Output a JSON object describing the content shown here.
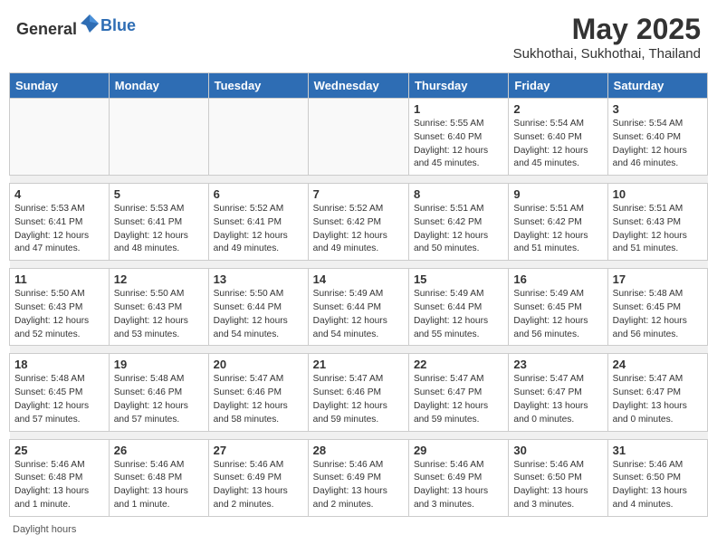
{
  "header": {
    "logo_general": "General",
    "logo_blue": "Blue",
    "main_title": "May 2025",
    "subtitle": "Sukhothai, Sukhothai, Thailand"
  },
  "days_of_week": [
    "Sunday",
    "Monday",
    "Tuesday",
    "Wednesday",
    "Thursday",
    "Friday",
    "Saturday"
  ],
  "weeks": [
    [
      {
        "day": "",
        "info": ""
      },
      {
        "day": "",
        "info": ""
      },
      {
        "day": "",
        "info": ""
      },
      {
        "day": "",
        "info": ""
      },
      {
        "day": "1",
        "info": "Sunrise: 5:55 AM\nSunset: 6:40 PM\nDaylight: 12 hours\nand 45 minutes."
      },
      {
        "day": "2",
        "info": "Sunrise: 5:54 AM\nSunset: 6:40 PM\nDaylight: 12 hours\nand 45 minutes."
      },
      {
        "day": "3",
        "info": "Sunrise: 5:54 AM\nSunset: 6:40 PM\nDaylight: 12 hours\nand 46 minutes."
      }
    ],
    [
      {
        "day": "4",
        "info": "Sunrise: 5:53 AM\nSunset: 6:41 PM\nDaylight: 12 hours\nand 47 minutes."
      },
      {
        "day": "5",
        "info": "Sunrise: 5:53 AM\nSunset: 6:41 PM\nDaylight: 12 hours\nand 48 minutes."
      },
      {
        "day": "6",
        "info": "Sunrise: 5:52 AM\nSunset: 6:41 PM\nDaylight: 12 hours\nand 49 minutes."
      },
      {
        "day": "7",
        "info": "Sunrise: 5:52 AM\nSunset: 6:42 PM\nDaylight: 12 hours\nand 49 minutes."
      },
      {
        "day": "8",
        "info": "Sunrise: 5:51 AM\nSunset: 6:42 PM\nDaylight: 12 hours\nand 50 minutes."
      },
      {
        "day": "9",
        "info": "Sunrise: 5:51 AM\nSunset: 6:42 PM\nDaylight: 12 hours\nand 51 minutes."
      },
      {
        "day": "10",
        "info": "Sunrise: 5:51 AM\nSunset: 6:43 PM\nDaylight: 12 hours\nand 51 minutes."
      }
    ],
    [
      {
        "day": "11",
        "info": "Sunrise: 5:50 AM\nSunset: 6:43 PM\nDaylight: 12 hours\nand 52 minutes."
      },
      {
        "day": "12",
        "info": "Sunrise: 5:50 AM\nSunset: 6:43 PM\nDaylight: 12 hours\nand 53 minutes."
      },
      {
        "day": "13",
        "info": "Sunrise: 5:50 AM\nSunset: 6:44 PM\nDaylight: 12 hours\nand 54 minutes."
      },
      {
        "day": "14",
        "info": "Sunrise: 5:49 AM\nSunset: 6:44 PM\nDaylight: 12 hours\nand 54 minutes."
      },
      {
        "day": "15",
        "info": "Sunrise: 5:49 AM\nSunset: 6:44 PM\nDaylight: 12 hours\nand 55 minutes."
      },
      {
        "day": "16",
        "info": "Sunrise: 5:49 AM\nSunset: 6:45 PM\nDaylight: 12 hours\nand 56 minutes."
      },
      {
        "day": "17",
        "info": "Sunrise: 5:48 AM\nSunset: 6:45 PM\nDaylight: 12 hours\nand 56 minutes."
      }
    ],
    [
      {
        "day": "18",
        "info": "Sunrise: 5:48 AM\nSunset: 6:45 PM\nDaylight: 12 hours\nand 57 minutes."
      },
      {
        "day": "19",
        "info": "Sunrise: 5:48 AM\nSunset: 6:46 PM\nDaylight: 12 hours\nand 57 minutes."
      },
      {
        "day": "20",
        "info": "Sunrise: 5:47 AM\nSunset: 6:46 PM\nDaylight: 12 hours\nand 58 minutes."
      },
      {
        "day": "21",
        "info": "Sunrise: 5:47 AM\nSunset: 6:46 PM\nDaylight: 12 hours\nand 59 minutes."
      },
      {
        "day": "22",
        "info": "Sunrise: 5:47 AM\nSunset: 6:47 PM\nDaylight: 12 hours\nand 59 minutes."
      },
      {
        "day": "23",
        "info": "Sunrise: 5:47 AM\nSunset: 6:47 PM\nDaylight: 13 hours\nand 0 minutes."
      },
      {
        "day": "24",
        "info": "Sunrise: 5:47 AM\nSunset: 6:47 PM\nDaylight: 13 hours\nand 0 minutes."
      }
    ],
    [
      {
        "day": "25",
        "info": "Sunrise: 5:46 AM\nSunset: 6:48 PM\nDaylight: 13 hours\nand 1 minute."
      },
      {
        "day": "26",
        "info": "Sunrise: 5:46 AM\nSunset: 6:48 PM\nDaylight: 13 hours\nand 1 minute."
      },
      {
        "day": "27",
        "info": "Sunrise: 5:46 AM\nSunset: 6:49 PM\nDaylight: 13 hours\nand 2 minutes."
      },
      {
        "day": "28",
        "info": "Sunrise: 5:46 AM\nSunset: 6:49 PM\nDaylight: 13 hours\nand 2 minutes."
      },
      {
        "day": "29",
        "info": "Sunrise: 5:46 AM\nSunset: 6:49 PM\nDaylight: 13 hours\nand 3 minutes."
      },
      {
        "day": "30",
        "info": "Sunrise: 5:46 AM\nSunset: 6:50 PM\nDaylight: 13 hours\nand 3 minutes."
      },
      {
        "day": "31",
        "info": "Sunrise: 5:46 AM\nSunset: 6:50 PM\nDaylight: 13 hours\nand 4 minutes."
      }
    ]
  ],
  "footer": "Daylight hours"
}
